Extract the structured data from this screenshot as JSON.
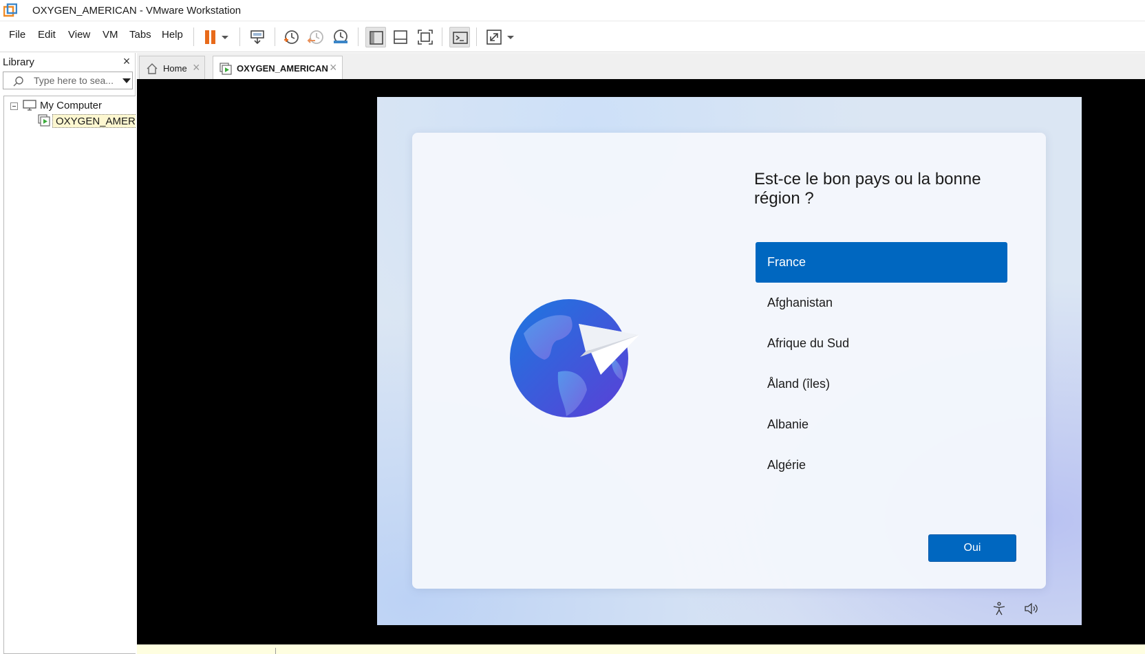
{
  "window": {
    "title": "OXYGEN_AMERICAN - VMware Workstation"
  },
  "menu": {
    "file": "File",
    "edit": "Edit",
    "view": "View",
    "vm": "VM",
    "tabs": "Tabs",
    "help": "Help"
  },
  "toolbar": {
    "icons": [
      "pause-icon",
      "dropdown-arrow-icon",
      "send-ctrl-alt-del-icon",
      "snapshot-take-icon",
      "snapshot-revert-icon",
      "snapshot-manager-icon",
      "show-library-icon",
      "show-thumbnail-bar-icon",
      "full-screen-icon",
      "console-view-icon",
      "stretch-guest-icon"
    ]
  },
  "library": {
    "title": "Library",
    "close": "×",
    "search_placeholder": "Type here to sea...",
    "tree": {
      "root": "My Computer",
      "vm": "OXYGEN_AMERIC"
    }
  },
  "tabs": [
    {
      "label": "Home",
      "close": "×"
    },
    {
      "label": "OXYGEN_AMERICAN",
      "close": "×"
    }
  ],
  "oobe": {
    "question": "Est-ce le bon pays ou la bonne région ?",
    "countries": [
      "France",
      "Afghanistan",
      "Afrique du Sud",
      "Åland (îles)",
      "Albanie",
      "Algérie"
    ],
    "selected_index": 0,
    "button": "Oui"
  },
  "colors": {
    "accent": "#0067c0",
    "pause": "#e86a1a",
    "vm_background": "#000000"
  }
}
